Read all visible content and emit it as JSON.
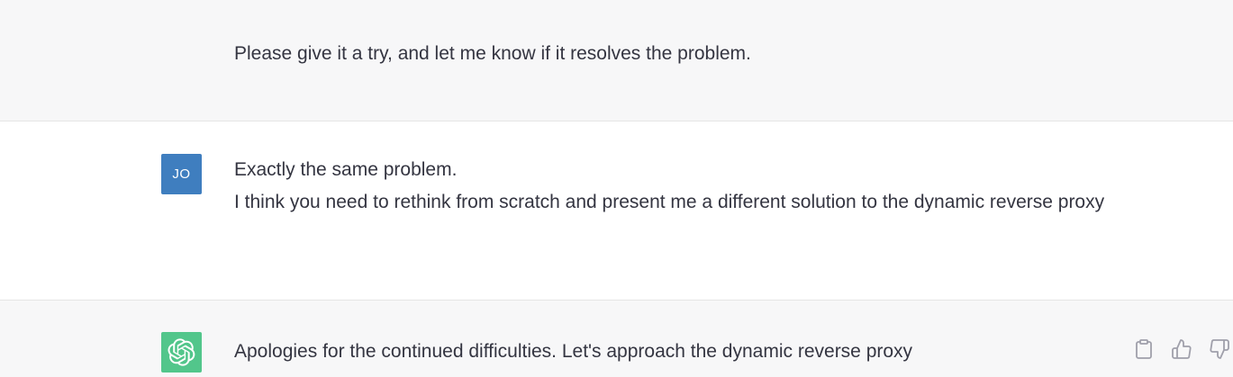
{
  "messages": [
    {
      "role": "assistant",
      "lines": [
        "Please give it a try, and let me know if it resolves the problem."
      ]
    },
    {
      "role": "user",
      "avatar_initials": "JO",
      "avatar_color": "#3f7ebf",
      "lines": [
        "Exactly the same problem.",
        "I think you need to rethink from scratch and present me a different solution to the dynamic reverse proxy"
      ]
    },
    {
      "role": "assistant",
      "avatar_icon": "openai-logo-icon",
      "avatar_color": "#52c68b",
      "lines": [
        "Apologies for the continued difficulties. Let's approach the dynamic reverse proxy"
      ]
    }
  ],
  "actions": {
    "copy_icon": "clipboard-icon",
    "like_icon": "thumbs-up-icon",
    "dislike_icon": "thumbs-down-icon"
  },
  "colors": {
    "assistant_bg": "#f7f7f8",
    "user_bg": "#ffffff",
    "text": "#343541",
    "icon_gray": "#a0a0ab"
  }
}
